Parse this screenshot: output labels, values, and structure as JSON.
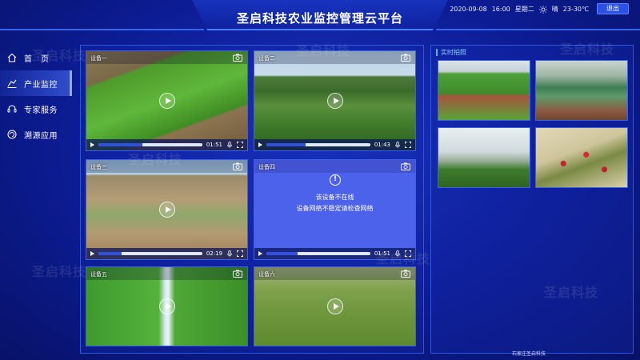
{
  "header": {
    "title": "圣启科技农业监控管理云平台",
    "date": "2020-09-08",
    "time": "16:00",
    "weekday": "星期二",
    "weather": "晴",
    "temperature": "23-30℃",
    "logout_label": "退出"
  },
  "sidebar": {
    "items": [
      {
        "label": "首　页",
        "icon": "home-icon"
      },
      {
        "label": "产业监控",
        "icon": "monitor-icon",
        "active": true
      },
      {
        "label": "专家服务",
        "icon": "headset-icon"
      },
      {
        "label": "溯源应用",
        "icon": "trace-icon"
      }
    ]
  },
  "cameras": [
    {
      "label": "设备一",
      "time": "01:51",
      "progress": 0.42,
      "online": true
    },
    {
      "label": "设备二",
      "time": "01:43",
      "progress": 0.38,
      "online": true
    },
    {
      "label": "设备三",
      "time": "02:19",
      "progress": 0.22,
      "online": true
    },
    {
      "label": "设备四",
      "time": "01:51",
      "progress": 0.3,
      "online": false,
      "offline_title": "该设备不在线",
      "offline_detail": "设备网络不稳定请检查网络"
    },
    {
      "label": "设备五",
      "online": true
    },
    {
      "label": "设备六",
      "online": true
    }
  ],
  "snapshots": {
    "title": "实时拍照"
  },
  "footer": "石家庄圣启科技",
  "watermark": "圣启科技",
  "colors": {
    "accent": "#2a50e6",
    "panel_border": "#2e57e0",
    "offline_bg": "#4d62ea"
  }
}
